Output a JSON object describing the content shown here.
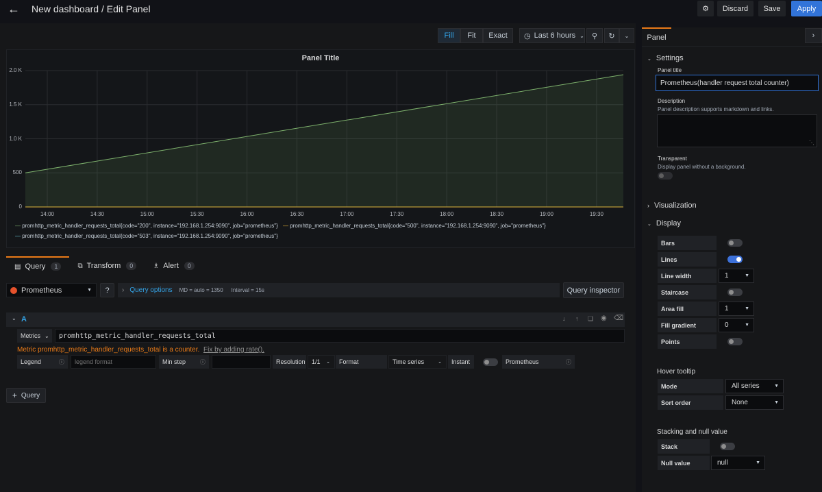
{
  "header": {
    "back_icon": "arrow-left-icon",
    "title": "New dashboard / Edit Panel",
    "settings_icon": "gear-icon",
    "discard": "Discard",
    "save": "Save",
    "apply": "Apply",
    "accent": "#3274d9"
  },
  "toolbar": {
    "fill": "Fill",
    "fit": "Fit",
    "exact": "Exact",
    "time_range": "Last 6 hours",
    "clock_icon": "clock-icon",
    "zoom_out_icon": "zoom-out-icon",
    "refresh_icon": "refresh-icon",
    "chevron_icon": "chevron-down-icon"
  },
  "panel": {
    "title": "Panel Title"
  },
  "chart_data": {
    "type": "area",
    "title": "Panel Title",
    "x": [
      "14:00",
      "14:30",
      "15:00",
      "15:30",
      "16:00",
      "16:30",
      "17:00",
      "17:30",
      "18:00",
      "18:30",
      "19:00",
      "19:30"
    ],
    "y_ticks": [
      "0",
      "500",
      "1.0 K",
      "1.5 K",
      "2.0 K"
    ],
    "ylim": [
      0,
      2000
    ],
    "grid": true,
    "series": [
      {
        "name": "promhttp_metric_handler_requests_total{code=\"200\", instance=\"192.168.1.254:9090\", job=\"prometheus\"}",
        "color": "#7eb26d",
        "start": 500,
        "end": 1940
      },
      {
        "name": "promhttp_metric_handler_requests_total{code=\"500\", instance=\"192.168.1.254:9090\", job=\"prometheus\"}",
        "color": "#eab839",
        "start": 0,
        "end": 0
      },
      {
        "name": "promhttp_metric_handler_requests_total{code=\"503\", instance=\"192.168.1.254:9090\", job=\"prometheus\"}",
        "color": "#6ed0e0",
        "start": 0,
        "end": 0
      }
    ],
    "legend_placement": "bottom"
  },
  "query_tabs": [
    {
      "label": "Query",
      "count": "1",
      "icon": "database-icon"
    },
    {
      "label": "Transform",
      "count": "0",
      "icon": "transform-icon"
    },
    {
      "label": "Alert",
      "count": "0",
      "icon": "bell-icon"
    }
  ],
  "query": {
    "datasource": "Prometheus",
    "datasource_icon": "prometheus-icon",
    "help_icon": "question-circle-icon",
    "options_label": "Query options",
    "md": "MD = auto = 1350",
    "interval": "Interval = 15s",
    "inspector": "Query inspector",
    "ref_id": "A",
    "metrics_label": "Metrics",
    "metric_value": "promhttp_metric_handler_requests_total",
    "warning": "Metric promhttp_metric_handler_requests_total is a counter.",
    "fix_link": "Fix by adding rate().",
    "legend_label": "Legend",
    "legend_placeholder": "legend format",
    "min_step_label": "Min step",
    "resolution_label": "Resolution",
    "resolution_value": "1/1",
    "format_label": "Format",
    "format_value": "Time series",
    "instant_label": "Instant",
    "prom_label": "Prometheus",
    "add_query": "Query",
    "warning_color": "#eb7b18"
  },
  "side": {
    "tab": "Panel",
    "settings": "Settings",
    "panel_title_label": "Panel title",
    "panel_title_value": "Prometheus(handler request total counter)",
    "description_label": "Description",
    "description_hint": "Panel description supports markdown and links.",
    "transparent_label": "Transparent",
    "transparent_hint": "Display panel without a background.",
    "visualization": "Visualization",
    "display": "Display",
    "bars": "Bars",
    "lines": "Lines",
    "line_width": "Line width",
    "line_width_value": "1",
    "staircase": "Staircase",
    "area_fill": "Area fill",
    "area_fill_value": "1",
    "fill_gradient": "Fill gradient",
    "fill_gradient_value": "0",
    "points": "Points",
    "hover_tooltip": "Hover tooltip",
    "mode": "Mode",
    "mode_value": "All series",
    "sort_order": "Sort order",
    "sort_order_value": "None",
    "stacking": "Stacking and null value",
    "stack": "Stack",
    "null_value": "Null value",
    "null_value_value": "null"
  }
}
